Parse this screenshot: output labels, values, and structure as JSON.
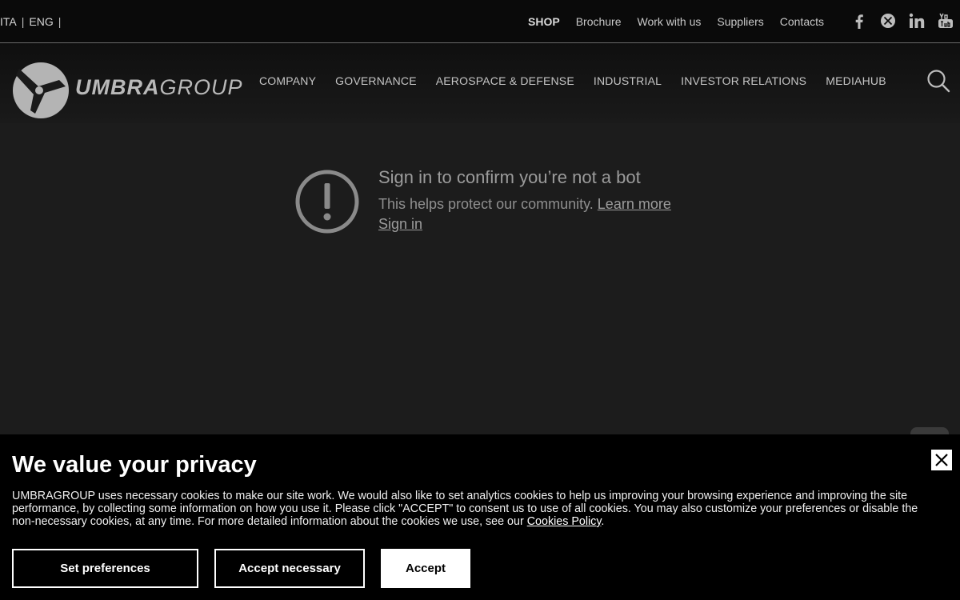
{
  "topbar": {
    "languages": [
      "ITA",
      "ENG"
    ],
    "separator": "|",
    "links": [
      "SHOP",
      "Brochure",
      "Work with us",
      "Suppliers",
      "Contacts"
    ],
    "social_icons": [
      "facebook-icon",
      "x-twitter-icon",
      "linkedin-icon",
      "youtube-icon"
    ]
  },
  "header": {
    "logo_bold": "UMBRA",
    "logo_light": "GROUP",
    "nav": [
      "COMPANY",
      "GOVERNANCE",
      "AEROSPACE & DEFENSE",
      "INDUSTRIAL",
      "INVESTOR RELATIONS",
      "MEDIAHUB"
    ],
    "search_icon": "search-icon"
  },
  "botcheck": {
    "title": "Sign in to confirm you’re not a bot",
    "description": "This helps protect our community.",
    "learn_more": "Learn more",
    "sign_in": "Sign in"
  },
  "cookie": {
    "title": "We value your privacy",
    "text": "UMBRAGROUP uses necessary cookies to make our site work. We would also like to set analytics cookies to help us improving your browsing experience and improving the site performance, by collecting some information on how you use it. Please click \"ACCEPT\" to consent us to use of all cookies. You may also customize your preferences or disable the non-necessary cookies, at any time. For more detailed information about the cookies we use, see our",
    "policy_link": "Cookies Policy",
    "period": ".",
    "buttons": {
      "preferences": "Set preferences",
      "necessary": "Accept necessary",
      "accept": "Accept"
    }
  },
  "colors": {
    "page_bg": "#1c1c1c",
    "topbar_bg": "#0a0a0a",
    "banner_bg": "#000000",
    "accept_bg": "#ffffff"
  }
}
